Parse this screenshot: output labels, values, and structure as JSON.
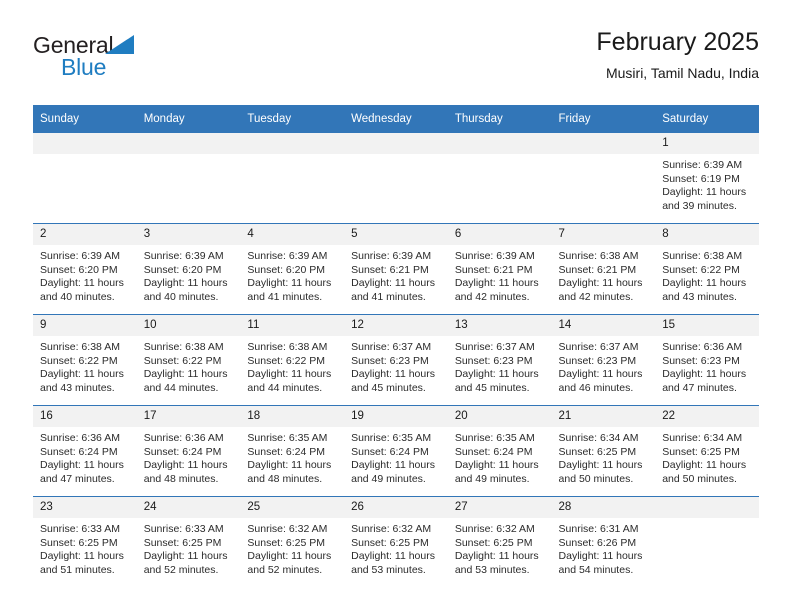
{
  "brand": {
    "word1": "General",
    "word2": "Blue",
    "triangle_color": "#1f7dc1",
    "text_color": "#231f20"
  },
  "header": {
    "title": "February 2025",
    "subtitle": "Musiri, Tamil Nadu, India"
  },
  "theme": {
    "header_bg": "#3276b8",
    "daynum_bg": "#f2f2f2",
    "grid_line": "#3276b8"
  },
  "weekdays": [
    "Sunday",
    "Monday",
    "Tuesday",
    "Wednesday",
    "Thursday",
    "Friday",
    "Saturday"
  ],
  "weeks": [
    [
      {
        "day": "",
        "lines": []
      },
      {
        "day": "",
        "lines": []
      },
      {
        "day": "",
        "lines": []
      },
      {
        "day": "",
        "lines": []
      },
      {
        "day": "",
        "lines": []
      },
      {
        "day": "",
        "lines": []
      },
      {
        "day": "1",
        "lines": [
          "Sunrise: 6:39 AM",
          "Sunset: 6:19 PM",
          "Daylight: 11 hours",
          "and 39 minutes."
        ]
      }
    ],
    [
      {
        "day": "2",
        "lines": [
          "Sunrise: 6:39 AM",
          "Sunset: 6:20 PM",
          "Daylight: 11 hours",
          "and 40 minutes."
        ]
      },
      {
        "day": "3",
        "lines": [
          "Sunrise: 6:39 AM",
          "Sunset: 6:20 PM",
          "Daylight: 11 hours",
          "and 40 minutes."
        ]
      },
      {
        "day": "4",
        "lines": [
          "Sunrise: 6:39 AM",
          "Sunset: 6:20 PM",
          "Daylight: 11 hours",
          "and 41 minutes."
        ]
      },
      {
        "day": "5",
        "lines": [
          "Sunrise: 6:39 AM",
          "Sunset: 6:21 PM",
          "Daylight: 11 hours",
          "and 41 minutes."
        ]
      },
      {
        "day": "6",
        "lines": [
          "Sunrise: 6:39 AM",
          "Sunset: 6:21 PM",
          "Daylight: 11 hours",
          "and 42 minutes."
        ]
      },
      {
        "day": "7",
        "lines": [
          "Sunrise: 6:38 AM",
          "Sunset: 6:21 PM",
          "Daylight: 11 hours",
          "and 42 minutes."
        ]
      },
      {
        "day": "8",
        "lines": [
          "Sunrise: 6:38 AM",
          "Sunset: 6:22 PM",
          "Daylight: 11 hours",
          "and 43 minutes."
        ]
      }
    ],
    [
      {
        "day": "9",
        "lines": [
          "Sunrise: 6:38 AM",
          "Sunset: 6:22 PM",
          "Daylight: 11 hours",
          "and 43 minutes."
        ]
      },
      {
        "day": "10",
        "lines": [
          "Sunrise: 6:38 AM",
          "Sunset: 6:22 PM",
          "Daylight: 11 hours",
          "and 44 minutes."
        ]
      },
      {
        "day": "11",
        "lines": [
          "Sunrise: 6:38 AM",
          "Sunset: 6:22 PM",
          "Daylight: 11 hours",
          "and 44 minutes."
        ]
      },
      {
        "day": "12",
        "lines": [
          "Sunrise: 6:37 AM",
          "Sunset: 6:23 PM",
          "Daylight: 11 hours",
          "and 45 minutes."
        ]
      },
      {
        "day": "13",
        "lines": [
          "Sunrise: 6:37 AM",
          "Sunset: 6:23 PM",
          "Daylight: 11 hours",
          "and 45 minutes."
        ]
      },
      {
        "day": "14",
        "lines": [
          "Sunrise: 6:37 AM",
          "Sunset: 6:23 PM",
          "Daylight: 11 hours",
          "and 46 minutes."
        ]
      },
      {
        "day": "15",
        "lines": [
          "Sunrise: 6:36 AM",
          "Sunset: 6:23 PM",
          "Daylight: 11 hours",
          "and 47 minutes."
        ]
      }
    ],
    [
      {
        "day": "16",
        "lines": [
          "Sunrise: 6:36 AM",
          "Sunset: 6:24 PM",
          "Daylight: 11 hours",
          "and 47 minutes."
        ]
      },
      {
        "day": "17",
        "lines": [
          "Sunrise: 6:36 AM",
          "Sunset: 6:24 PM",
          "Daylight: 11 hours",
          "and 48 minutes."
        ]
      },
      {
        "day": "18",
        "lines": [
          "Sunrise: 6:35 AM",
          "Sunset: 6:24 PM",
          "Daylight: 11 hours",
          "and 48 minutes."
        ]
      },
      {
        "day": "19",
        "lines": [
          "Sunrise: 6:35 AM",
          "Sunset: 6:24 PM",
          "Daylight: 11 hours",
          "and 49 minutes."
        ]
      },
      {
        "day": "20",
        "lines": [
          "Sunrise: 6:35 AM",
          "Sunset: 6:24 PM",
          "Daylight: 11 hours",
          "and 49 minutes."
        ]
      },
      {
        "day": "21",
        "lines": [
          "Sunrise: 6:34 AM",
          "Sunset: 6:25 PM",
          "Daylight: 11 hours",
          "and 50 minutes."
        ]
      },
      {
        "day": "22",
        "lines": [
          "Sunrise: 6:34 AM",
          "Sunset: 6:25 PM",
          "Daylight: 11 hours",
          "and 50 minutes."
        ]
      }
    ],
    [
      {
        "day": "23",
        "lines": [
          "Sunrise: 6:33 AM",
          "Sunset: 6:25 PM",
          "Daylight: 11 hours",
          "and 51 minutes."
        ]
      },
      {
        "day": "24",
        "lines": [
          "Sunrise: 6:33 AM",
          "Sunset: 6:25 PM",
          "Daylight: 11 hours",
          "and 52 minutes."
        ]
      },
      {
        "day": "25",
        "lines": [
          "Sunrise: 6:32 AM",
          "Sunset: 6:25 PM",
          "Daylight: 11 hours",
          "and 52 minutes."
        ]
      },
      {
        "day": "26",
        "lines": [
          "Sunrise: 6:32 AM",
          "Sunset: 6:25 PM",
          "Daylight: 11 hours",
          "and 53 minutes."
        ]
      },
      {
        "day": "27",
        "lines": [
          "Sunrise: 6:32 AM",
          "Sunset: 6:25 PM",
          "Daylight: 11 hours",
          "and 53 minutes."
        ]
      },
      {
        "day": "28",
        "lines": [
          "Sunrise: 6:31 AM",
          "Sunset: 6:26 PM",
          "Daylight: 11 hours",
          "and 54 minutes."
        ]
      },
      {
        "day": "",
        "lines": []
      }
    ]
  ]
}
